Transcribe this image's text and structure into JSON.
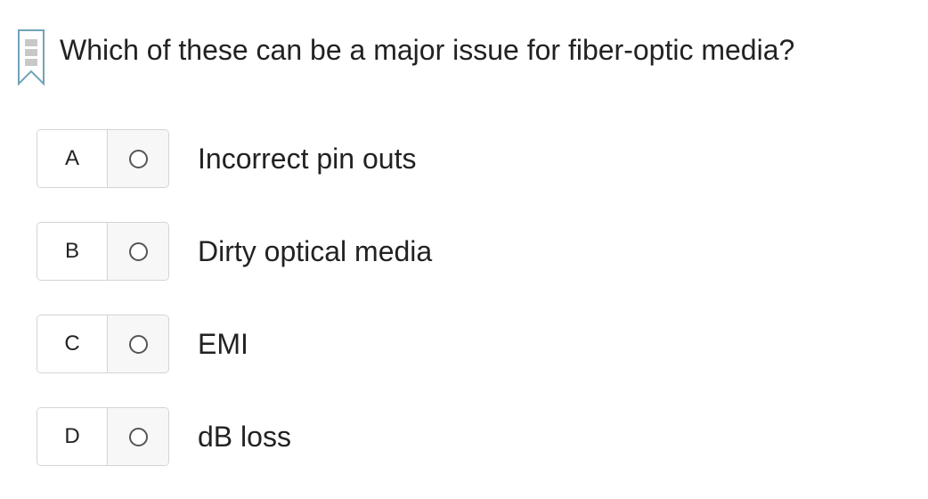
{
  "icons": {
    "bookmark": "bookmark-flag-icon",
    "radio": "radio-unchecked-icon"
  },
  "colors": {
    "bookmark_stroke": "#6fa3b8",
    "bookmark_dots": "#c8c8c8",
    "border": "#d4d4d4",
    "radio_bg": "#f7f7f7",
    "text": "#222222"
  },
  "question": {
    "text": "Which of these can be a major issue for fiber-optic media?"
  },
  "options": [
    {
      "letter": "A",
      "text": "Incorrect pin outs",
      "selected": false
    },
    {
      "letter": "B",
      "text": "Dirty optical media",
      "selected": false
    },
    {
      "letter": "C",
      "text": "EMI",
      "selected": false
    },
    {
      "letter": "D",
      "text": "dB loss",
      "selected": false
    }
  ]
}
